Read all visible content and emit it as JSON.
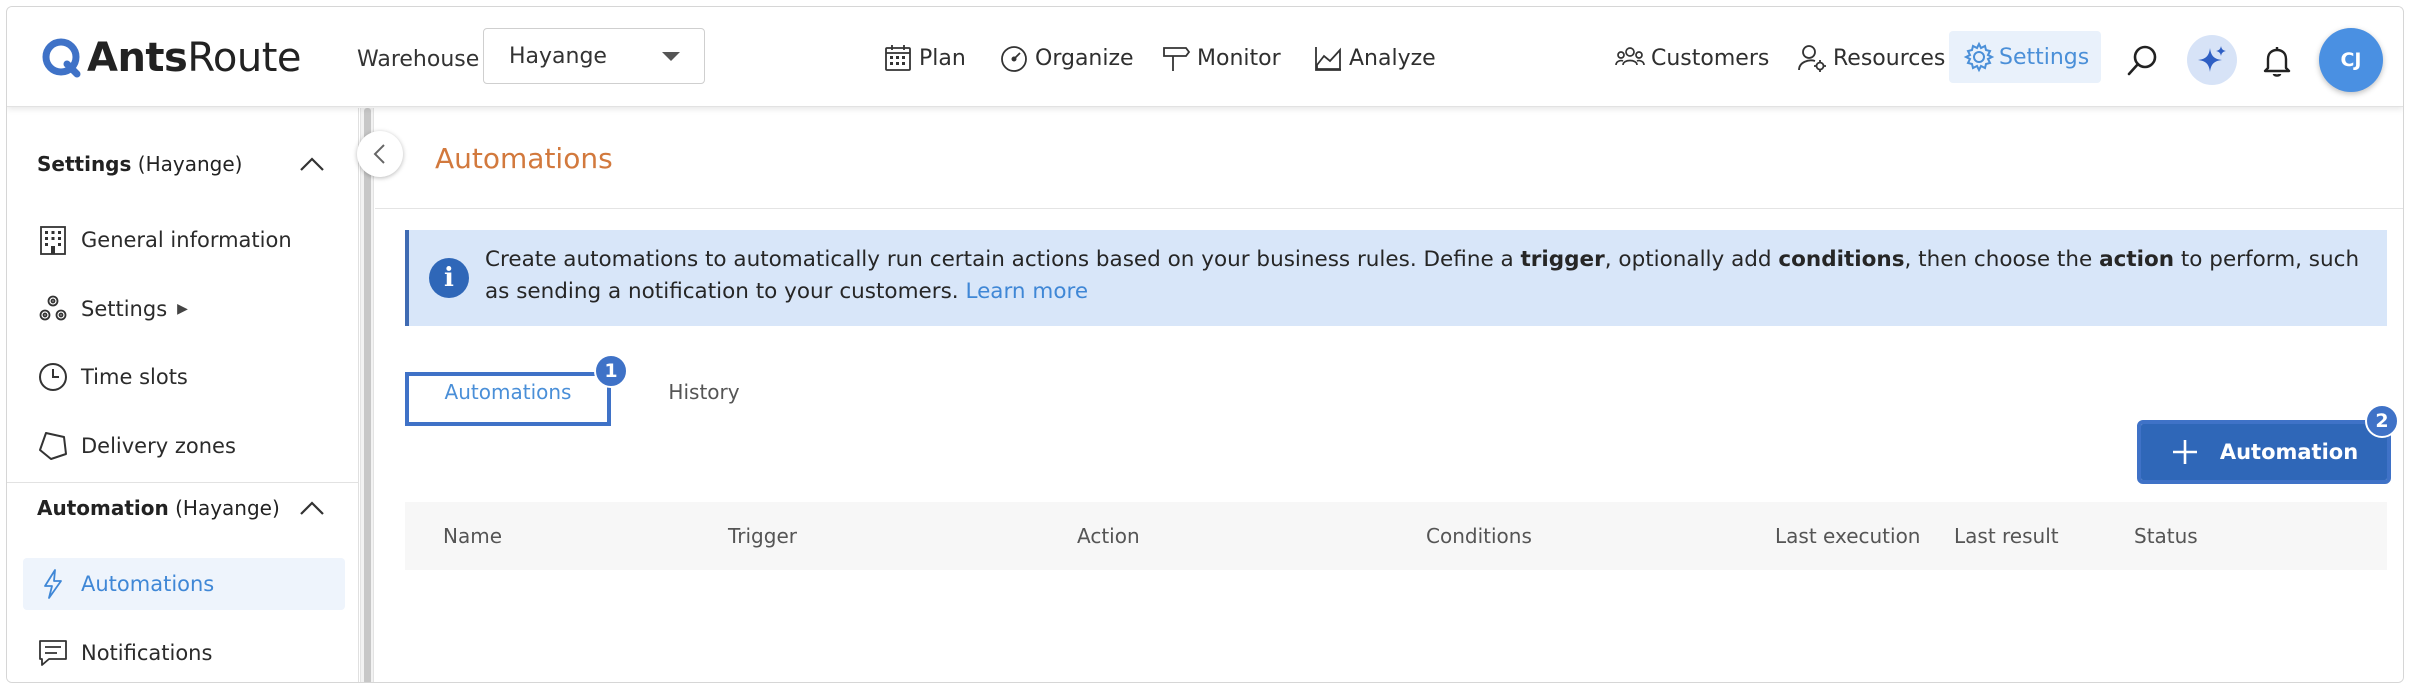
{
  "header": {
    "logo_bold": "Ants",
    "logo_regular": "Route",
    "warehouse_label": "Warehouse",
    "warehouse_value": "Hayange",
    "nav": {
      "plan": "Plan",
      "organize": "Organize",
      "monitor": "Monitor",
      "analyze": "Analyze",
      "customers": "Customers",
      "resources": "Resources",
      "settings": "Settings"
    },
    "avatar_initials": "CJ"
  },
  "sidebar": {
    "settings_section": {
      "title": "Settings",
      "context": " (Hayange)"
    },
    "settings_items": [
      {
        "label": "General information",
        "icon": "building-icon"
      },
      {
        "label": "Settings",
        "icon": "cogs-icon",
        "arrow": "▶"
      },
      {
        "label": "Time slots",
        "icon": "clock-icon"
      },
      {
        "label": "Delivery zones",
        "icon": "polygon-icon"
      }
    ],
    "automation_section": {
      "title": "Automation",
      "context": " (Hayange)"
    },
    "automation_items": [
      {
        "label": "Automations",
        "icon": "lightning-icon",
        "active": true
      },
      {
        "label": "Notifications",
        "icon": "message-icon"
      }
    ]
  },
  "main": {
    "title": "Automations",
    "info": {
      "t1": "Create automations to automatically run certain actions based on your business rules. Define a ",
      "b1": "trigger",
      "t2": ", optionally add ",
      "b2": "conditions",
      "t3": ", then choose the ",
      "b3": "action",
      "t4": " to perform, such as sending a notification to your customers. ",
      "link": "Learn more"
    },
    "tabs": [
      {
        "label": "Automations",
        "badge": "1"
      },
      {
        "label": "History"
      }
    ],
    "add_button": {
      "label": "Automation",
      "badge": "2"
    },
    "columns": [
      "Name",
      "Trigger",
      "Action",
      "Conditions",
      "Last execution",
      "Last result",
      "Status"
    ]
  },
  "colors": {
    "accent": "#4a8fd8",
    "title_orange": "#d2793d",
    "info_bg": "#d8e6f9",
    "primary_button": "#2f67b8",
    "highlight_border": "#3f72c7"
  }
}
